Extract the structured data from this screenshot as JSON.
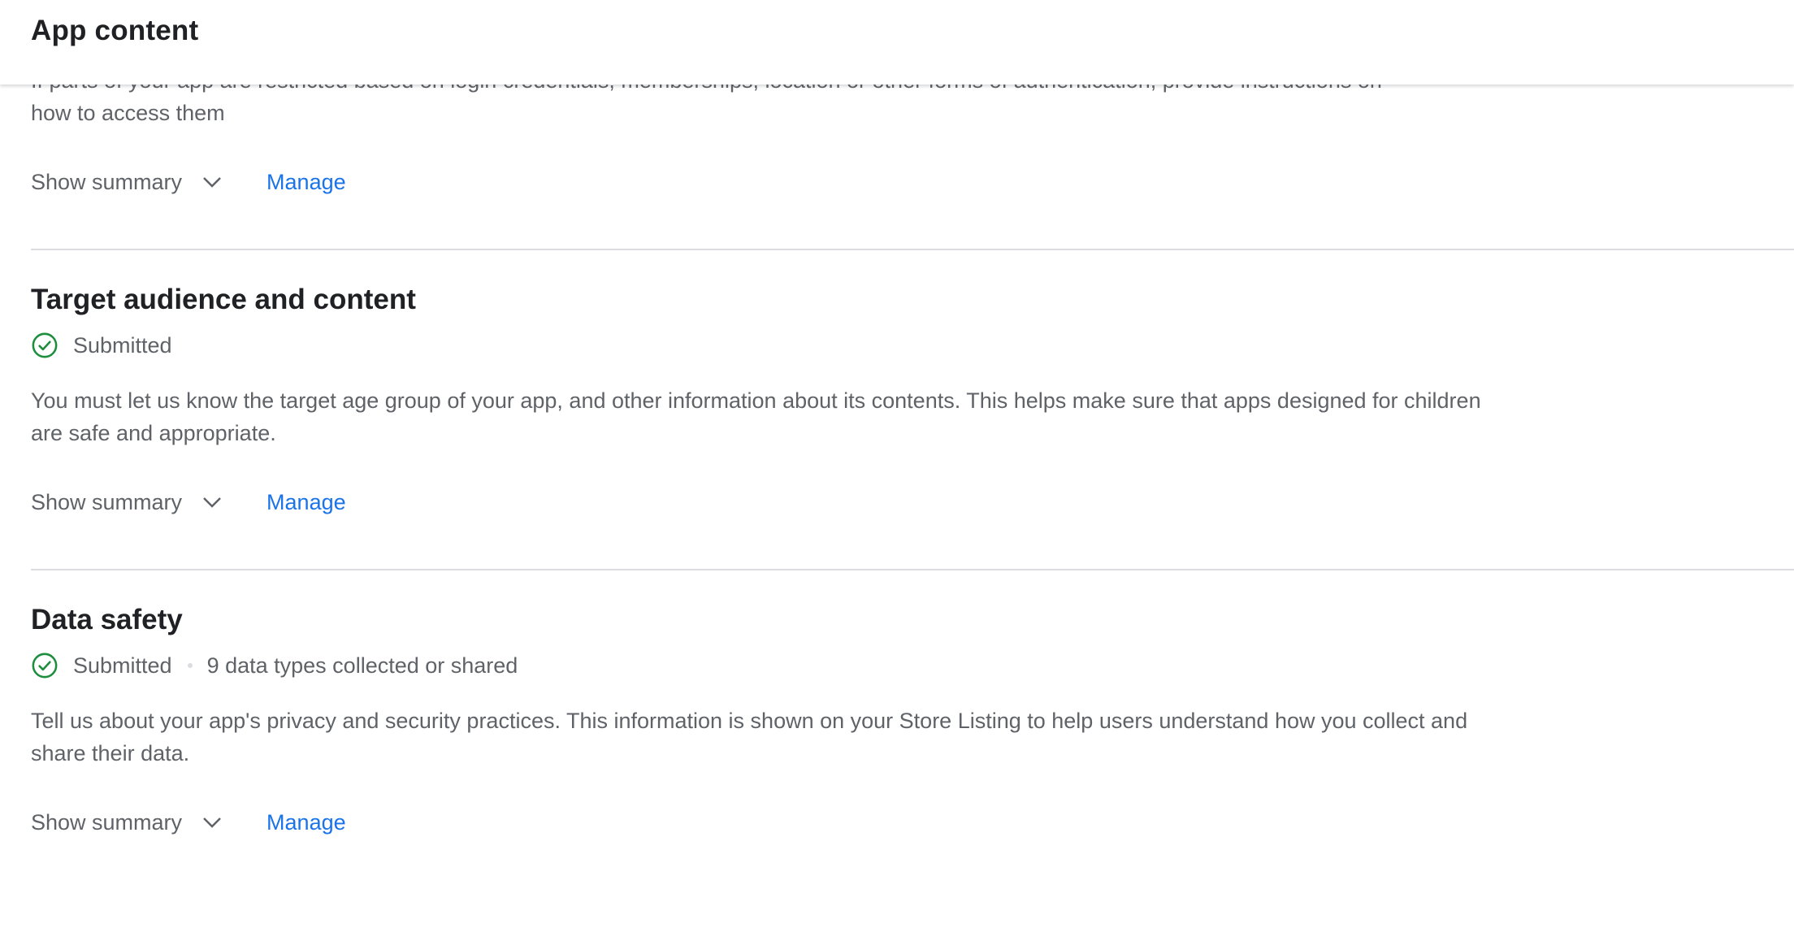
{
  "header": {
    "title": "App content"
  },
  "sections": [
    {
      "clipped_text_line1": "If parts of your app are restricted based on login credentials, memberships, location or other forms of authentication, provide instructions on",
      "clipped_text_line2": "how to access them",
      "show_summary_label": "Show summary",
      "manage_label": "Manage"
    },
    {
      "title": "Target audience and content",
      "status": "Submitted",
      "description": "You must let us know the target age group of your app, and other information about its contents. This helps make sure that apps designed for children are safe and appropriate.",
      "show_summary_label": "Show summary",
      "manage_label": "Manage"
    },
    {
      "title": "Data safety",
      "status": "Submitted",
      "status_detail": "9 data types collected or shared",
      "description": "Tell us about your app's privacy and security practices. This information is shown on your Store Listing to help users understand how you collect and share their data.",
      "show_summary_label": "Show summary",
      "manage_label": "Manage"
    }
  ],
  "colors": {
    "link": "#1a73e8",
    "success": "#1e8e3e",
    "text_secondary": "#5f6368",
    "divider": "#dadce0"
  },
  "icons": {
    "status": "check-circle-icon",
    "expand": "chevron-down-icon"
  }
}
